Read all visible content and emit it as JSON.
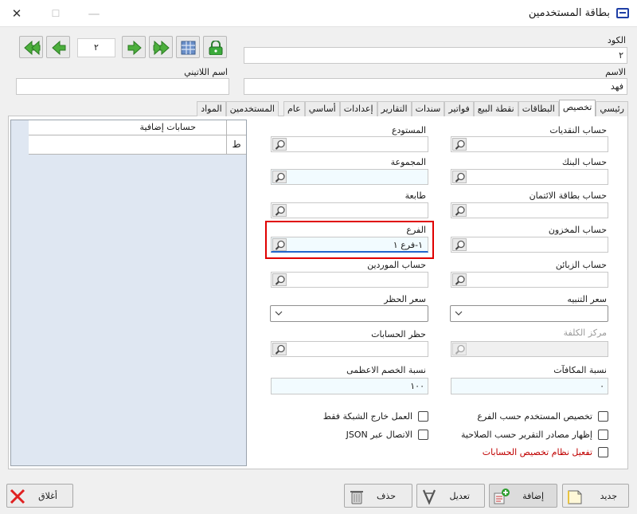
{
  "window": {
    "title": "بطاقة المستخدمين",
    "close_glyph": "✕",
    "max_glyph": "☐",
    "min_glyph": "—"
  },
  "nav": {
    "record_number": "٢"
  },
  "header": {
    "code_label": "الكود",
    "code_value": "٢",
    "name_label": "الاسم",
    "name_value": "فهد",
    "latin_name_label": "اسم اللاتيني",
    "latin_name_value": ""
  },
  "tabs": [
    "رئيسي",
    "تخصيص",
    "البطاقات",
    "نقطة البيع",
    "فواتير",
    "سندات",
    "التقارير",
    "إعدادات",
    "أساسي",
    "عام",
    "المستخدمين",
    "المواد"
  ],
  "active_tab": 1,
  "grid": {
    "column_header": "حسابات إضافية",
    "row_marker": "ﻁ"
  },
  "fields_right": {
    "cash_account": "حساب النقديات",
    "bank_account": "حساب البنك",
    "credit_card_account": "حساب بطاقة الائتمان",
    "inventory_account": "حساب المخزون",
    "customers_account": "حساب الزبائن",
    "alert_price": "سعر التنبيه",
    "cost_center": "مركز الكلفة",
    "rewards_ratio": "نسبة المكافآت",
    "rewards_ratio_value": "٠"
  },
  "fields_left": {
    "warehouse": "المستودع",
    "group": "المجموعة",
    "printer": "طابعة",
    "branch": "الفرع",
    "branch_value": "١-فرع ١",
    "suppliers_account": "حساب الموردين",
    "ban_price": "سعر الحظر",
    "ban_accounts": "حظر الحسابات",
    "max_discount": "نسبة الخصم الاعظمى",
    "max_discount_value": "١٠٠"
  },
  "checkboxes": {
    "user_by_branch": "تخصيص المستخدم حسب الفرع",
    "report_sources": "إظهار مصادر التقرير حسب الصلاحية",
    "accounts_system": "تفعيل نظام تخصيص الحسابات",
    "offline_only": "العمل خارج الشبكة فقط",
    "json_connection": "الاتصال عبر JSON"
  },
  "buttons": {
    "new": "جديد",
    "add": "إضافة",
    "edit": "تعديل",
    "delete": "حذف",
    "close": "أغلاق"
  },
  "colors": {
    "accent_red": "#e00000",
    "grid_bg": "#dfe7f2",
    "field_blue": "#f2fbff",
    "nav_green": "#2e9e2e"
  }
}
